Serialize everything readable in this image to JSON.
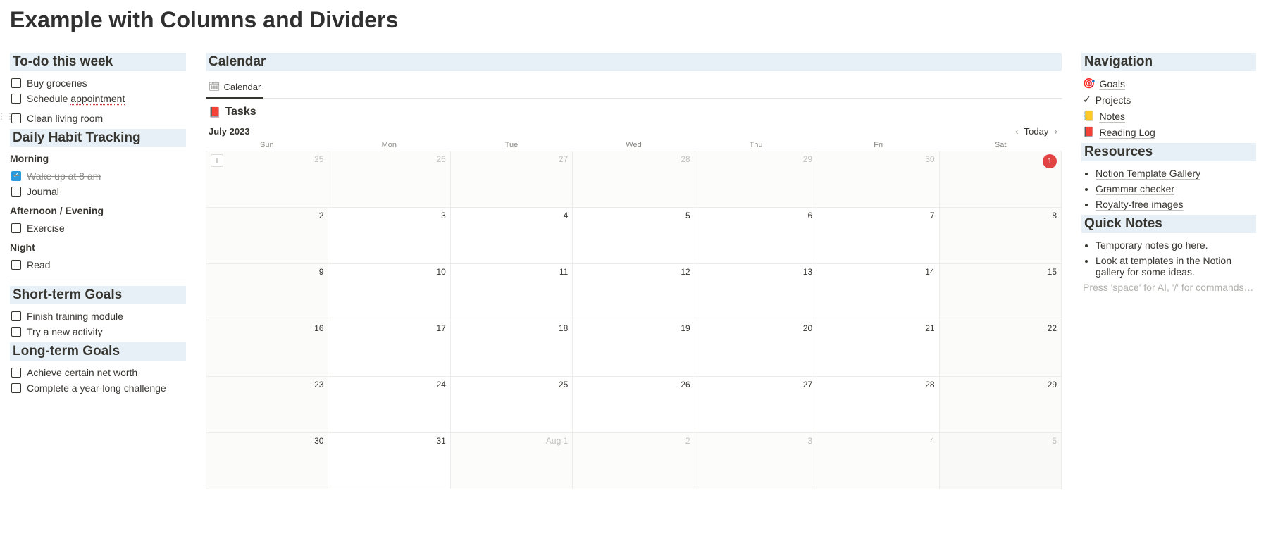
{
  "page_title": "Example with Columns and Dividers",
  "left": {
    "todo": {
      "heading": "To-do this week",
      "items": [
        {
          "label": "Buy groceries",
          "checked": false
        },
        {
          "label_pre": "Schedule ",
          "label_spell": "appointment",
          "checked": false
        },
        {
          "label": "Clean living room",
          "checked": false,
          "show_handle": true
        }
      ]
    },
    "habits": {
      "heading": "Daily Habit Tracking",
      "morning_label": "Morning",
      "morning": [
        {
          "label": "Wake up at 8 am",
          "checked": true
        },
        {
          "label": "Journal",
          "checked": false
        }
      ],
      "afternoon_label": "Afternoon / Evening",
      "afternoon": [
        {
          "label": "Exercise",
          "checked": false
        }
      ],
      "night_label": "Night",
      "night": [
        {
          "label": "Read",
          "checked": false
        }
      ]
    },
    "short_goals": {
      "heading": "Short-term Goals",
      "items": [
        {
          "label": "Finish training module",
          "checked": false
        },
        {
          "label": "Try a new activity",
          "checked": false
        }
      ]
    },
    "long_goals": {
      "heading": "Long-term Goals",
      "items": [
        {
          "label": "Achieve certain net worth",
          "checked": false
        },
        {
          "label": "Complete a year-long challenge",
          "checked": false
        }
      ]
    }
  },
  "calendar": {
    "heading": "Calendar",
    "tab_label": "Calendar",
    "tasks_icon": "📕",
    "tasks_label": "Tasks",
    "month_label": "July 2023",
    "today_label": "Today",
    "day_headers": [
      "Sun",
      "Mon",
      "Tue",
      "Wed",
      "Thu",
      "Fri",
      "Sat"
    ],
    "cells": [
      {
        "num": "25",
        "other": true,
        "show_plus": true
      },
      {
        "num": "26",
        "other": true
      },
      {
        "num": "27",
        "other": true
      },
      {
        "num": "28",
        "other": true
      },
      {
        "num": "29",
        "other": true
      },
      {
        "num": "30",
        "other": true
      },
      {
        "num": "1",
        "today": true,
        "weekend": true
      },
      {
        "num": "2",
        "weekend": true
      },
      {
        "num": "3"
      },
      {
        "num": "4"
      },
      {
        "num": "5"
      },
      {
        "num": "6"
      },
      {
        "num": "7"
      },
      {
        "num": "8",
        "weekend": true
      },
      {
        "num": "9",
        "weekend": true
      },
      {
        "num": "10"
      },
      {
        "num": "11"
      },
      {
        "num": "12"
      },
      {
        "num": "13"
      },
      {
        "num": "14"
      },
      {
        "num": "15",
        "weekend": true
      },
      {
        "num": "16",
        "weekend": true
      },
      {
        "num": "17"
      },
      {
        "num": "18"
      },
      {
        "num": "19"
      },
      {
        "num": "20"
      },
      {
        "num": "21"
      },
      {
        "num": "22",
        "weekend": true
      },
      {
        "num": "23",
        "weekend": true
      },
      {
        "num": "24"
      },
      {
        "num": "25"
      },
      {
        "num": "26"
      },
      {
        "num": "27"
      },
      {
        "num": "28"
      },
      {
        "num": "29",
        "weekend": true
      },
      {
        "num": "30",
        "weekend": true
      },
      {
        "num": "31"
      },
      {
        "num": "Aug 1",
        "other": true
      },
      {
        "num": "2",
        "other": true
      },
      {
        "num": "3",
        "other": true
      },
      {
        "num": "4",
        "other": true
      },
      {
        "num": "5",
        "other": true,
        "weekend": true
      }
    ]
  },
  "right": {
    "navigation": {
      "heading": "Navigation",
      "items": [
        {
          "icon": "🎯",
          "label": "Goals"
        },
        {
          "icon": "✓",
          "label": "Projects",
          "icon_color": "#37352f"
        },
        {
          "icon": "📒",
          "label": "Notes"
        },
        {
          "icon": "📕",
          "label": "Reading Log"
        }
      ]
    },
    "resources": {
      "heading": "Resources",
      "items": [
        "Notion Template Gallery",
        "Grammar checker",
        "Royalty-free images"
      ]
    },
    "quick_notes": {
      "heading": "Quick Notes",
      "items": [
        "Temporary notes go here.",
        "Look at templates in the Notion gallery for some ideas."
      ],
      "placeholder": "Press 'space' for AI, '/' for commands…"
    }
  }
}
